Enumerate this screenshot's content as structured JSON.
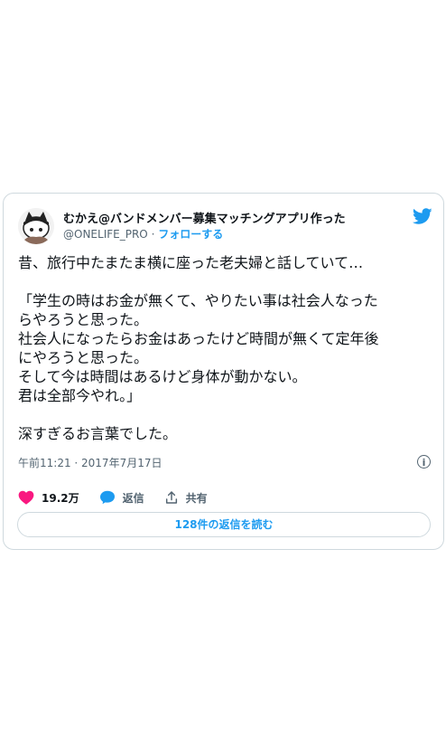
{
  "tweet": {
    "author_name": "むかえ@バンドメンバー募集マッチングアプリ作った",
    "author_handle": "@ONELIFE_PRO",
    "separator": "·",
    "follow_label": "フォローする",
    "lines": [
      "昔、旅行中たまたま横に座った老夫婦と話していて…",
      "",
      "「学生の時はお金が無くて、やりたい事は社会人なった",
      "らやろうと思った。",
      "社会人になったらお金はあったけど時間が無くて定年後",
      "にやろうと思った。",
      "そして今は時間はあるけど身体が動かない。",
      "君は全部今やれ。」",
      "",
      "深すぎるお言葉でした。"
    ],
    "timestamp": "午前11:21 · 2017年7月17日",
    "info_glyph": "i",
    "likes": "19.2万",
    "reply_label": "返信",
    "share_label": "共有",
    "read_replies_label": "128件の返信を読む"
  },
  "colors": {
    "accent": "#1d9bf0",
    "like": "#f91880",
    "muted": "#536471",
    "text": "#0f1419",
    "border": "#cfd9de"
  },
  "icons": {
    "brand": "twitter-bird-icon",
    "like": "heart-icon",
    "reply": "speech-bubble-icon",
    "share": "share-icon",
    "info": "info-icon"
  }
}
